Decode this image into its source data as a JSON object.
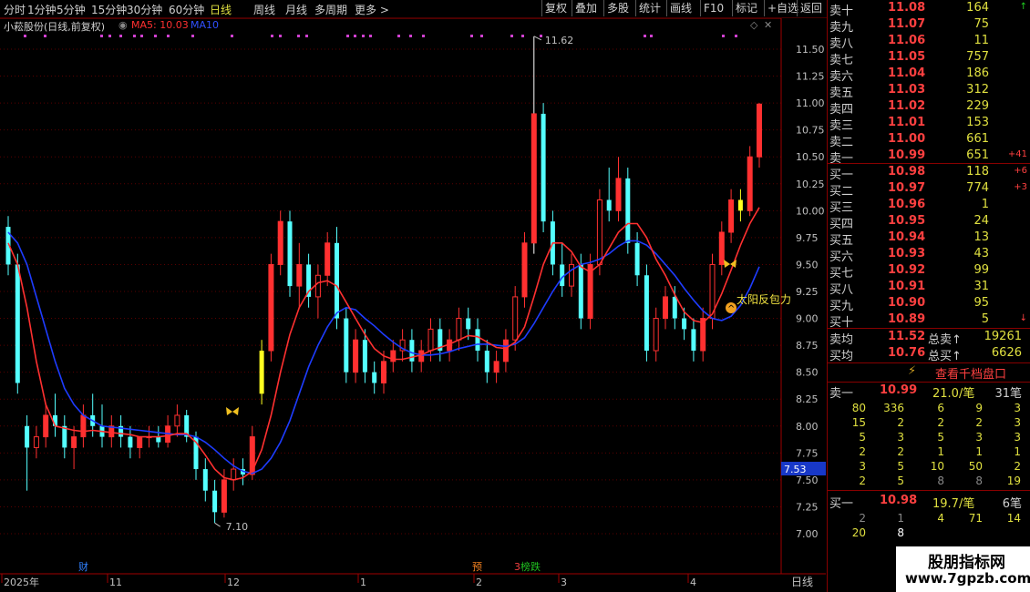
{
  "toolbar": {
    "periods": [
      "分时",
      "1分钟",
      "5分钟",
      "15分钟",
      "30分钟",
      "60分钟",
      "日线",
      "周线",
      "月线",
      "多周期",
      "更多 >"
    ],
    "active": "日线",
    "buttons": [
      "复权",
      "叠加",
      "多股",
      "统计",
      "画线",
      "F10",
      "标记",
      "+自选",
      "返回"
    ]
  },
  "chart_header": {
    "title": "小菘股份(日线,前复权)",
    "ma5": "MA5: 10.03",
    "ma10": "MA10",
    "ma5_color": "#ff3030",
    "ma10_color": "#3050ff"
  },
  "annotations": {
    "high_label": "11.62",
    "low_label": "7.10",
    "signal_text": "太阳反包力",
    "current_price_tag": "7.53"
  },
  "x_axis_labels": [
    "2025年",
    "11",
    "12",
    "1",
    "2",
    "3",
    "4"
  ],
  "bottom_right_label": "日线",
  "event_markers": [
    "财",
    "预",
    "3",
    "榜跌"
  ],
  "chart_data": {
    "type": "candlestick",
    "y_ticks": [
      "11.50",
      "11.25",
      "11.00",
      "10.75",
      "10.50",
      "10.25",
      "10.00",
      "9.75",
      "9.50",
      "9.25",
      "9.00",
      "8.75",
      "8.50",
      "8.25",
      "8.00",
      "7.75",
      "7.50",
      "7.25",
      "7.00"
    ],
    "ylim": [
      7.0,
      11.5
    ],
    "up_color": "#ff3030",
    "down_color": "#54ffff",
    "ma5_color": "#ff3030",
    "ma10_color": "#1e3cff",
    "candles": [
      [
        9.85,
        9.95,
        9.4,
        9.5
      ],
      [
        9.5,
        9.6,
        8.3,
        8.4
      ],
      [
        8.0,
        8.1,
        7.4,
        7.8
      ],
      [
        7.8,
        8.0,
        7.7,
        7.9
      ],
      [
        7.9,
        8.2,
        7.8,
        8.1
      ],
      [
        8.1,
        8.3,
        7.9,
        8.0
      ],
      [
        8.0,
        8.1,
        7.7,
        7.8
      ],
      [
        7.8,
        8.0,
        7.6,
        7.9
      ],
      [
        7.9,
        8.2,
        7.8,
        8.1
      ],
      [
        8.1,
        8.3,
        7.9,
        8.0
      ],
      [
        8.0,
        8.2,
        7.8,
        7.9
      ],
      [
        7.9,
        8.1,
        7.8,
        8.0
      ],
      [
        8.0,
        8.1,
        7.8,
        7.9
      ],
      [
        7.9,
        8.0,
        7.7,
        7.8
      ],
      [
        7.8,
        7.9,
        7.7,
        7.9
      ],
      [
        7.9,
        8.0,
        7.8,
        7.9
      ],
      [
        7.9,
        8.0,
        7.8,
        7.85
      ],
      [
        7.85,
        8.1,
        7.8,
        8.0
      ],
      [
        8.0,
        8.2,
        7.9,
        8.1
      ],
      [
        8.1,
        8.15,
        7.85,
        7.9
      ],
      [
        7.9,
        7.95,
        7.5,
        7.6
      ],
      [
        7.6,
        7.7,
        7.3,
        7.4
      ],
      [
        7.4,
        7.5,
        7.1,
        7.2
      ],
      [
        7.2,
        7.6,
        7.15,
        7.5
      ],
      [
        7.5,
        7.7,
        7.4,
        7.6
      ],
      [
        7.6,
        7.7,
        7.45,
        7.55
      ],
      [
        7.55,
        8.0,
        7.5,
        7.9
      ],
      [
        8.3,
        8.8,
        8.2,
        8.7
      ],
      [
        8.7,
        9.6,
        8.6,
        9.5
      ],
      [
        9.5,
        10.0,
        9.4,
        9.9
      ],
      [
        9.9,
        10.0,
        9.2,
        9.3
      ],
      [
        9.3,
        9.7,
        9.1,
        9.5
      ],
      [
        9.5,
        9.6,
        9.1,
        9.2
      ],
      [
        9.2,
        9.5,
        9.0,
        9.4
      ],
      [
        9.4,
        9.8,
        9.3,
        9.7
      ],
      [
        9.7,
        9.85,
        8.9,
        9.0
      ],
      [
        9.0,
        9.1,
        8.4,
        8.5
      ],
      [
        8.5,
        8.9,
        8.4,
        8.8
      ],
      [
        8.8,
        8.9,
        8.4,
        8.5
      ],
      [
        8.5,
        8.6,
        8.3,
        8.4
      ],
      [
        8.4,
        8.7,
        8.3,
        8.6
      ],
      [
        8.6,
        8.8,
        8.5,
        8.7
      ],
      [
        8.7,
        8.9,
        8.6,
        8.8
      ],
      [
        8.8,
        8.9,
        8.5,
        8.6
      ],
      [
        8.6,
        8.8,
        8.5,
        8.7
      ],
      [
        8.7,
        9.0,
        8.6,
        8.9
      ],
      [
        8.9,
        9.0,
        8.6,
        8.7
      ],
      [
        8.7,
        8.9,
        8.6,
        8.8
      ],
      [
        8.8,
        9.1,
        8.7,
        9.0
      ],
      [
        9.0,
        9.1,
        8.8,
        8.9
      ],
      [
        8.9,
        9.0,
        8.6,
        8.7
      ],
      [
        8.7,
        8.8,
        8.4,
        8.5
      ],
      [
        8.5,
        8.7,
        8.4,
        8.6
      ],
      [
        8.6,
        8.9,
        8.5,
        8.8
      ],
      [
        8.8,
        9.3,
        8.7,
        9.2
      ],
      [
        9.2,
        9.8,
        9.1,
        9.7
      ],
      [
        9.7,
        11.62,
        9.6,
        10.9
      ],
      [
        10.9,
        11.0,
        9.8,
        9.9
      ],
      [
        9.9,
        10.0,
        9.4,
        9.5
      ],
      [
        9.5,
        9.7,
        9.2,
        9.3
      ],
      [
        9.3,
        9.6,
        9.2,
        9.5
      ],
      [
        9.5,
        9.6,
        8.9,
        9.0
      ],
      [
        9.0,
        9.6,
        8.9,
        9.5
      ],
      [
        9.5,
        10.2,
        9.4,
        10.1
      ],
      [
        10.1,
        10.4,
        9.9,
        10.0
      ],
      [
        10.0,
        10.5,
        9.9,
        10.3
      ],
      [
        10.3,
        10.4,
        9.6,
        9.7
      ],
      [
        9.7,
        9.8,
        9.3,
        9.4
      ],
      [
        9.4,
        9.5,
        8.6,
        8.7
      ],
      [
        8.7,
        9.1,
        8.6,
        9.0
      ],
      [
        9.0,
        9.3,
        8.9,
        9.2
      ],
      [
        9.2,
        9.3,
        8.9,
        9.0
      ],
      [
        9.0,
        9.1,
        8.8,
        8.9
      ],
      [
        8.9,
        9.0,
        8.6,
        8.7
      ],
      [
        8.7,
        9.1,
        8.6,
        9.0
      ],
      [
        9.0,
        9.6,
        8.9,
        9.5
      ],
      [
        9.5,
        9.9,
        9.4,
        9.8
      ],
      [
        9.8,
        10.2,
        9.7,
        10.1
      ],
      [
        10.1,
        10.2,
        9.9,
        10.0
      ],
      [
        10.0,
        10.6,
        9.95,
        10.5
      ],
      [
        10.5,
        11.0,
        10.4,
        10.99
      ]
    ],
    "ma5": [
      9.7,
      9.5,
      9.1,
      8.6,
      8.2,
      8.0,
      7.98,
      7.96,
      7.95,
      7.96,
      7.95,
      7.94,
      7.93,
      7.92,
      7.9,
      7.9,
      7.9,
      7.91,
      7.93,
      7.93,
      7.85,
      7.73,
      7.6,
      7.52,
      7.5,
      7.52,
      7.58,
      7.78,
      8.1,
      8.5,
      8.85,
      9.1,
      9.25,
      9.33,
      9.35,
      9.3,
      9.15,
      9.0,
      8.85,
      8.72,
      8.65,
      8.62,
      8.62,
      8.64,
      8.66,
      8.7,
      8.73,
      8.76,
      8.8,
      8.84,
      8.83,
      8.78,
      8.73,
      8.72,
      8.78,
      8.92,
      9.2,
      9.5,
      9.7,
      9.7,
      9.62,
      9.48,
      9.43,
      9.5,
      9.65,
      9.8,
      9.88,
      9.88,
      9.75,
      9.55,
      9.4,
      9.22,
      9.06,
      8.98,
      8.96,
      9.04,
      9.23,
      9.45,
      9.68,
      9.88,
      10.03
    ],
    "ma10": [
      9.8,
      9.7,
      9.5,
      9.2,
      8.9,
      8.6,
      8.35,
      8.2,
      8.1,
      8.05,
      8.0,
      7.99,
      7.98,
      7.97,
      7.96,
      7.95,
      7.94,
      7.93,
      7.92,
      7.92,
      7.9,
      7.85,
      7.78,
      7.7,
      7.63,
      7.58,
      7.56,
      7.6,
      7.7,
      7.85,
      8.05,
      8.3,
      8.55,
      8.75,
      8.92,
      9.05,
      9.1,
      9.08,
      9.0,
      8.93,
      8.85,
      8.78,
      8.72,
      8.68,
      8.66,
      8.66,
      8.67,
      8.69,
      8.72,
      8.74,
      8.76,
      8.76,
      8.75,
      8.74,
      8.76,
      8.82,
      8.95,
      9.1,
      9.25,
      9.38,
      9.45,
      9.5,
      9.52,
      9.55,
      9.6,
      9.67,
      9.72,
      9.72,
      9.68,
      9.6,
      9.5,
      9.4,
      9.28,
      9.17,
      9.07,
      9.0,
      8.98,
      9.02,
      9.12,
      9.28,
      9.48
    ]
  },
  "order_book": {
    "asks": [
      {
        "label": "卖十",
        "price": "11.08",
        "vol": "164",
        "chg": "↑"
      },
      {
        "label": "卖九",
        "price": "11.07",
        "vol": "75",
        "chg": ""
      },
      {
        "label": "卖八",
        "price": "11.06",
        "vol": "11",
        "chg": ""
      },
      {
        "label": "卖七",
        "price": "11.05",
        "vol": "757",
        "chg": ""
      },
      {
        "label": "卖六",
        "price": "11.04",
        "vol": "186",
        "chg": ""
      },
      {
        "label": "卖五",
        "price": "11.03",
        "vol": "312",
        "chg": ""
      },
      {
        "label": "卖四",
        "price": "11.02",
        "vol": "229",
        "chg": ""
      },
      {
        "label": "卖三",
        "price": "11.01",
        "vol": "153",
        "chg": ""
      },
      {
        "label": "卖二",
        "price": "11.00",
        "vol": "661",
        "chg": ""
      },
      {
        "label": "卖一",
        "price": "10.99",
        "vol": "651",
        "chg": "+41"
      }
    ],
    "bids": [
      {
        "label": "买一",
        "price": "10.98",
        "vol": "118",
        "chg": "+6"
      },
      {
        "label": "买二",
        "price": "10.97",
        "vol": "774",
        "chg": "+3"
      },
      {
        "label": "买三",
        "price": "10.96",
        "vol": "1",
        "chg": ""
      },
      {
        "label": "买四",
        "price": "10.95",
        "vol": "24",
        "chg": ""
      },
      {
        "label": "买五",
        "price": "10.94",
        "vol": "13",
        "chg": ""
      },
      {
        "label": "买六",
        "price": "10.93",
        "vol": "43",
        "chg": ""
      },
      {
        "label": "买七",
        "price": "10.92",
        "vol": "99",
        "chg": ""
      },
      {
        "label": "买八",
        "price": "10.91",
        "vol": "31",
        "chg": ""
      },
      {
        "label": "买九",
        "price": "10.90",
        "vol": "95",
        "chg": ""
      },
      {
        "label": "买十",
        "price": "10.89",
        "vol": "5",
        "chg": "↓"
      }
    ],
    "avg_sell_label": "卖均",
    "avg_sell": "11.52",
    "total_sell_label": "总卖",
    "total_sell": "19261",
    "avg_buy_label": "买均",
    "avg_buy": "10.76",
    "total_buy_label": "总买",
    "total_buy": "6626",
    "view_thousand": "查看千档盘口"
  },
  "tick_detail": {
    "sell_header": {
      "label": "卖一",
      "price": "10.99",
      "per": "21.0/笔",
      "count": "31笔"
    },
    "sell_rows": [
      [
        "80",
        "336",
        "6",
        "9",
        "3"
      ],
      [
        "15",
        "2",
        "2",
        "2",
        "3"
      ],
      [
        "5",
        "3",
        "5",
        "3",
        "3"
      ],
      [
        "2",
        "2",
        "1",
        "1",
        "1"
      ],
      [
        "3",
        "5",
        "10",
        "50",
        "2"
      ],
      [
        "2",
        "5",
        "8",
        "8",
        "19"
      ]
    ],
    "buy_header": {
      "label": "买一",
      "price": "10.98",
      "per": "19.7/笔",
      "count": "6笔"
    },
    "buy_rows": [
      [
        "2",
        "1",
        "4",
        "71",
        "14"
      ],
      [
        "20",
        "8",
        "",
        "",
        ""
      ]
    ]
  },
  "watermark": {
    "title": "股朋指标网",
    "url": "www.7gpzb.com"
  }
}
